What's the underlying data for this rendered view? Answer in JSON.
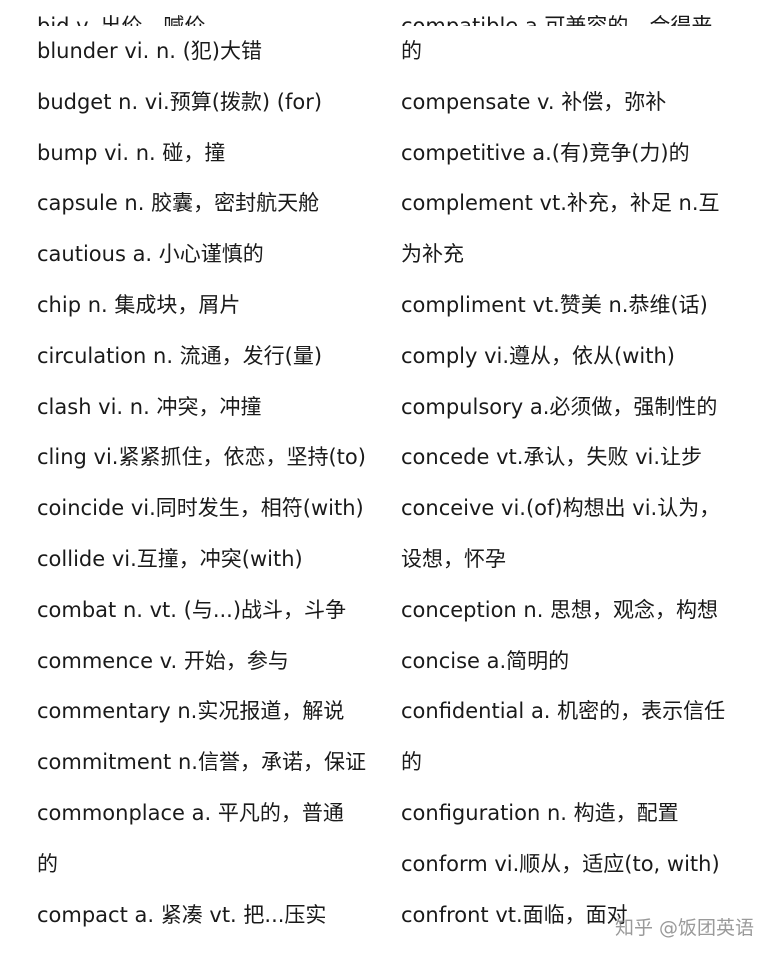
{
  "left_column": [
    "bid v.    出价，喊价",
    "blunder vi.  n. (犯)大错",
    "budget n. vi.预算(拨款) (for)",
    "bump vi. n.  碰，撞",
    "capsule n. 胶囊，密封航天舱",
    "cautious a. 小心谨慎的",
    "chip n. 集成块，屑片",
    "circulation n. 流通，发行(量)",
    "clash vi. n. 冲突，冲撞",
    "cling vi.紧紧抓住，依恋，坚持(to)",
    "coincide vi.同时发生，相符(with)",
    "collide vi.互撞，冲突(with)",
    "combat n. vt. (与...)战斗，斗争",
    "commence v. 开始，参与",
    "commentary n.实况报道，解说",
    "commitment n.信誉，承诺，保证",
    "commonplace a. 平凡的，普通",
    "的",
    "compact a. 紧凑  vt. 把...压实"
  ],
  "right_column": [
    "compatible a.可兼容的，合得来",
    "的",
    "compensate v. 补偿，弥补",
    "competitive a.(有)竞争(力)的",
    "complement vt.补充，补足  n.互",
    "为补充",
    "compliment vt.赞美  n.恭维(话)",
    "comply vi.遵从，依从(with)",
    "compulsory a.必须做，强制性的",
    "concede vt.承认，失败  vi.让步",
    "conceive vi.(of)构想出  vi.认为，",
    "设想，怀孕",
    "conception n. 思想，观念，构想",
    "concise a.简明的",
    "confidential a. 机密的，表示信任",
    "的",
    "configuration n. 构造，配置",
    "conform vi.顺从，适应(to, with)",
    "confront vt.面临，面对"
  ],
  "watermark": "知乎 @饭团英语"
}
